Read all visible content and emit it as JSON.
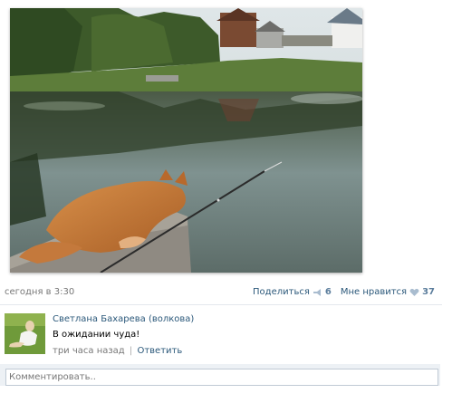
{
  "post": {
    "photo_icon": "cat-fishing-photo"
  },
  "meta": {
    "timestamp": "сегодня в 3:30",
    "share_label": "Поделиться",
    "share_count": "6",
    "like_label": "Мне нравится",
    "like_count": "37",
    "icons": {
      "share": "megaphone-icon",
      "like": "heart-icon"
    }
  },
  "comment": {
    "author": "Светлана Бахарева (волкова)",
    "text": "В ожидании чуда!",
    "time": "три часа назад",
    "separator": "|",
    "reply_label": "Ответить"
  },
  "reply_box": {
    "placeholder": "Комментировать.."
  },
  "colors": {
    "link": "#2b587a",
    "muted": "#777777",
    "count": "#5b7d9c",
    "reply_bg": "#edf1f5"
  }
}
